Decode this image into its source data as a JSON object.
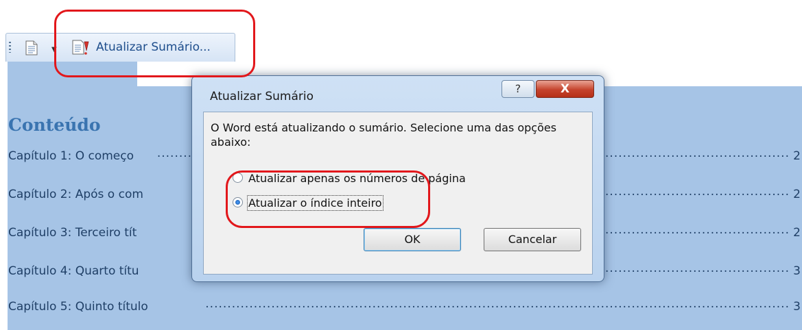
{
  "toolbar": {
    "update_toc_label": "Atualizar Sumário..."
  },
  "document": {
    "heading": "Conteúdo",
    "toc_entries": [
      {
        "title": "Capítulo 1: O começo",
        "page": "2"
      },
      {
        "title": "Capítulo 2: Após o com",
        "page": "2"
      },
      {
        "title": "Capítulo 3: Terceiro tít",
        "page": "2"
      },
      {
        "title": "Capítulo 4: Quarto títu",
        "page": "3"
      },
      {
        "title": "Capítulo 5: Quinto título",
        "page": "3"
      }
    ]
  },
  "dialog": {
    "title": "Atualizar Sumário",
    "help_glyph": "?",
    "close_glyph": "X",
    "message": "O Word está atualizando o sumário. Selecione uma das opções abaixo:",
    "options": [
      {
        "label": "Atualizar apenas os números de página",
        "selected": false
      },
      {
        "label": "Atualizar o índice inteiro",
        "selected": true
      }
    ],
    "ok_label": "OK",
    "cancel_label": "Cancelar"
  },
  "colors": {
    "accent_highlight": "#e2171b",
    "toc_shading": "#a6c4e6",
    "heading_color": "#3a74b0"
  }
}
